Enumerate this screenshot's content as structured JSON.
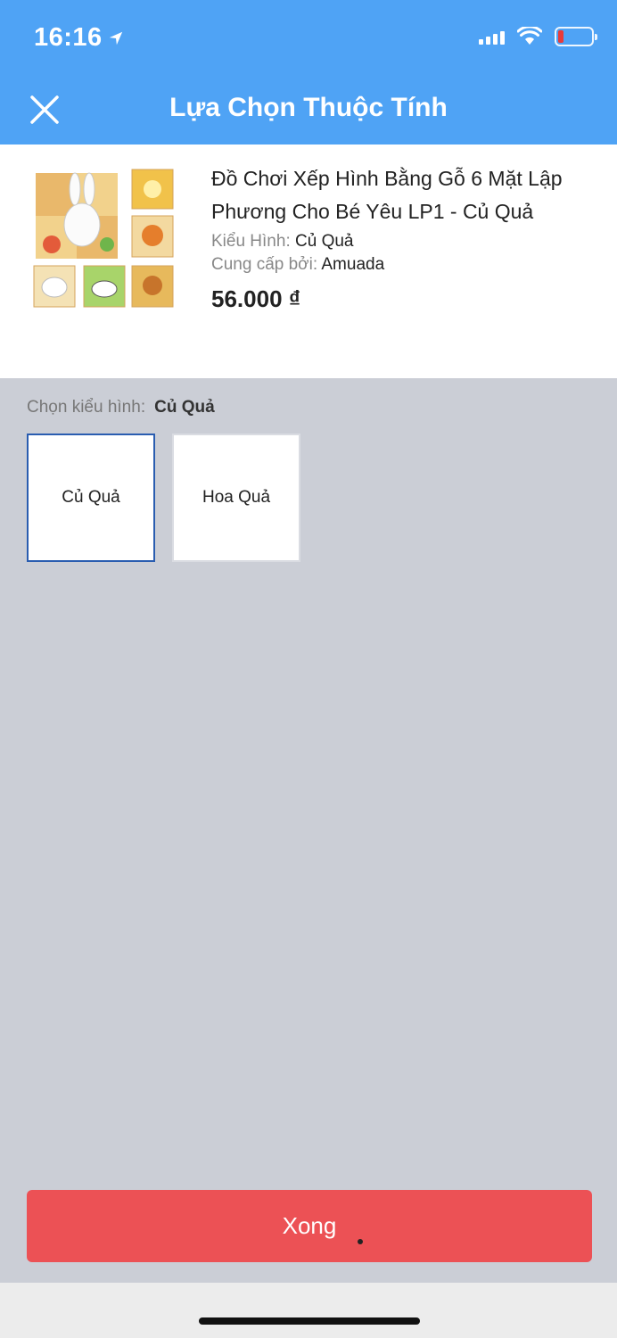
{
  "status_bar": {
    "time": "16:16",
    "icons": [
      "location-arrow-icon",
      "signal-icon",
      "wifi-icon",
      "battery-icon"
    ],
    "battery_color": "#e83a3a"
  },
  "header": {
    "title": "Lựa Chọn Thuộc Tính",
    "close_icon": "close-icon",
    "background": "#4fa3f5"
  },
  "product": {
    "image_icon": "wooden-cube-puzzle-image",
    "name": "Đồ Chơi Xếp Hình Bằng Gỗ 6 Mặt Lập Phương Cho Bé Yêu LP1 - Củ Quả",
    "style_label": "Kiểu Hình:",
    "style_value": "Củ Quả",
    "seller_label": "Cung cấp bởi:",
    "seller_value": "Amuada",
    "price": "56.000 ₫"
  },
  "selector": {
    "label": "Chọn kiểu hình:",
    "current": "Củ Quả",
    "options": [
      {
        "label": "Củ Quả",
        "selected": true
      },
      {
        "label": "Hoa Quả",
        "selected": false
      }
    ],
    "selected_border_color": "#2a5db0"
  },
  "footer": {
    "done_label": "Xong",
    "done_color": "#ec5155"
  }
}
